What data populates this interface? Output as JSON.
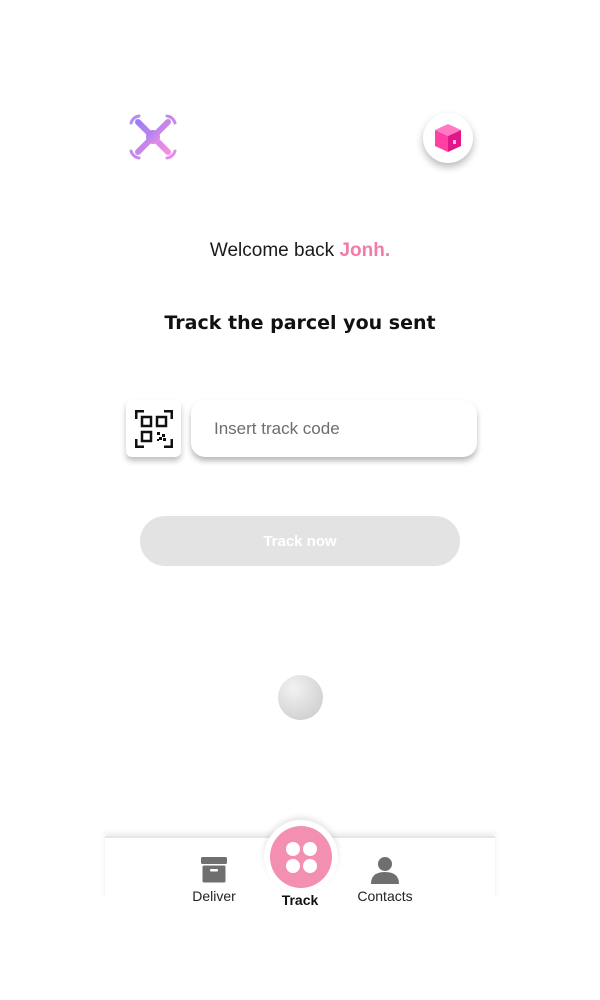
{
  "header": {
    "logo_icon": "drone-icon",
    "parcel_button_icon": "package-box-icon"
  },
  "welcome": {
    "prefix": "Welcome back",
    "name": "Jonh."
  },
  "headline": "Track the parcel you sent",
  "tracking": {
    "qr_icon": "qr-code-icon",
    "input_placeholder": "Insert track code",
    "input_value": "",
    "button_label": "Track now"
  },
  "nav": {
    "items": [
      {
        "label": "Deliver",
        "icon": "archive-box-icon"
      },
      {
        "label": "Track",
        "icon": "four-dots-icon",
        "active": true
      },
      {
        "label": "Contacts",
        "icon": "person-icon"
      }
    ]
  },
  "colors": {
    "accent_pink": "#f27ba8",
    "fab_pink": "#f38fb0",
    "disabled_button": "#e3e3e3",
    "icon_gray": "#6f6f6f"
  }
}
